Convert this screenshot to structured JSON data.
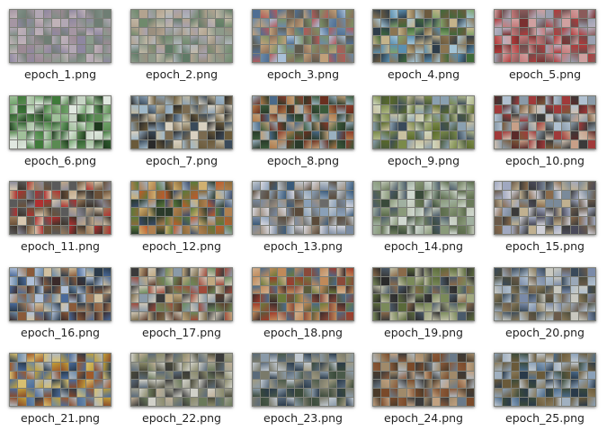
{
  "files": [
    {
      "name": "epoch_1.png",
      "palette": [
        "#8e87a0",
        "#a596a3",
        "#7f8f86",
        "#9b8a94",
        "#b2a7b4",
        "#6f7e74",
        "#c0b2b8",
        "#8a9b8c"
      ]
    },
    {
      "name": "epoch_2.png",
      "palette": [
        "#8d9a8a",
        "#a7a2b0",
        "#6f8a6c",
        "#b3a38f",
        "#c2b8a6",
        "#5f7a66",
        "#9a8f7f",
        "#b0b6bc"
      ]
    },
    {
      "name": "epoch_3.png",
      "palette": [
        "#6b8aa8",
        "#b45a5a",
        "#7c9367",
        "#4f6e93",
        "#c0a07a",
        "#8a6e5a",
        "#a9c0d8",
        "#5e5a4e"
      ]
    },
    {
      "name": "epoch_4.png",
      "palette": [
        "#3f6a3a",
        "#7fa36a",
        "#5a8fb0",
        "#8b7552",
        "#c5b38a",
        "#2e3d4a",
        "#a3c4d6",
        "#6c5a3e"
      ]
    },
    {
      "name": "epoch_5.png",
      "palette": [
        "#b23a3a",
        "#c77a7a",
        "#8a5a5a",
        "#9aa0b0",
        "#d0a0a0",
        "#6a4a4a",
        "#b8b0c0",
        "#7a3030"
      ]
    },
    {
      "name": "epoch_6.png",
      "palette": [
        "#2f5e2f",
        "#6fa36a",
        "#c6d4c4",
        "#3f7a3a",
        "#a0c09a",
        "#1e3a1e",
        "#e0e8e0",
        "#5a8a52"
      ]
    },
    {
      "name": "epoch_7.png",
      "palette": [
        "#3a4a5a",
        "#8aa0b4",
        "#6a5a3a",
        "#c0b8a0",
        "#2a2a2a",
        "#a0b8c8",
        "#7a6a50",
        "#d8d0c0"
      ]
    },
    {
      "name": "epoch_8.png",
      "palette": [
        "#8a3a2a",
        "#b07a4a",
        "#4a6a8a",
        "#3a5a3a",
        "#c0a07a",
        "#6a3020",
        "#9ab0c0",
        "#2a3a2a"
      ]
    },
    {
      "name": "epoch_9.png",
      "palette": [
        "#7a8a4a",
        "#b0b88a",
        "#4a5a3a",
        "#8aa0b0",
        "#c8c0a0",
        "#5a6a2a",
        "#d0d8c0",
        "#3a4a5a"
      ]
    },
    {
      "name": "epoch_10.png",
      "palette": [
        "#a03a3a",
        "#c8a088",
        "#3a3a3a",
        "#b0c0d0",
        "#7a5a3a",
        "#d0c0b0",
        "#5a2a2a",
        "#8a9aa8"
      ]
    },
    {
      "name": "epoch_11.png",
      "palette": [
        "#9a7a5a",
        "#3a3028",
        "#c0a888",
        "#b03030",
        "#5a5a5a",
        "#d8c8b0",
        "#6a5038",
        "#8a8a9a"
      ]
    },
    {
      "name": "epoch_12.png",
      "palette": [
        "#5a7a3a",
        "#c05a2a",
        "#3a4a6a",
        "#d0b070",
        "#8a6a3a",
        "#2a3a2a",
        "#a0b0c0",
        "#b08050"
      ]
    },
    {
      "name": "epoch_13.png",
      "palette": [
        "#7a8aa0",
        "#c0c8d0",
        "#5a4a3a",
        "#3a5a7a",
        "#a09080",
        "#d8d8e0",
        "#6a6a6a",
        "#8aa0b8"
      ]
    },
    {
      "name": "epoch_14.png",
      "palette": [
        "#6a7a5a",
        "#a0b0a0",
        "#3a4a3a",
        "#c0c8b8",
        "#8a9a7a",
        "#4a5a6a",
        "#d0d8d0",
        "#5a6a4a"
      ]
    },
    {
      "name": "epoch_15.png",
      "palette": [
        "#6a5a4a",
        "#a0a8c0",
        "#3a3a3a",
        "#c0b090",
        "#7a8a9a",
        "#8a6a4a",
        "#d0d0d8",
        "#4a4a5a"
      ]
    },
    {
      "name": "epoch_16.png",
      "palette": [
        "#4a6a9a",
        "#3a2a2a",
        "#b0c0d8",
        "#8a5a3a",
        "#6a8aa8",
        "#d0c0a0",
        "#2a3a4a",
        "#a07a5a"
      ]
    },
    {
      "name": "epoch_17.png",
      "palette": [
        "#a04a3a",
        "#6a8a5a",
        "#3a3a3a",
        "#c0a880",
        "#8a9aa8",
        "#5a3a2a",
        "#d0c8b8",
        "#7a6a4a"
      ]
    },
    {
      "name": "epoch_18.png",
      "palette": [
        "#a03a2a",
        "#6a7a3a",
        "#3a2a2a",
        "#c08a5a",
        "#4a6a8a",
        "#d0b090",
        "#8a4a3a",
        "#5a5a3a"
      ]
    },
    {
      "name": "epoch_19.png",
      "palette": [
        "#5a6a3a",
        "#3a3a3a",
        "#a0a880",
        "#8a6a4a",
        "#c0c0a8",
        "#4a5a6a",
        "#7a8a5a",
        "#2a2a2a"
      ]
    },
    {
      "name": "epoch_20.png",
      "palette": [
        "#7a8aa8",
        "#4a4a3a",
        "#b0c0d0",
        "#8a7a5a",
        "#3a4a5a",
        "#c8c8c0",
        "#6a5a4a",
        "#9aa8b8"
      ]
    },
    {
      "name": "epoch_21.png",
      "palette": [
        "#c0a03a",
        "#4a6a9a",
        "#a05a2a",
        "#2a3a4a",
        "#d8c070",
        "#6a8aa8",
        "#8a4a2a",
        "#b0b8c0"
      ]
    },
    {
      "name": "epoch_22.png",
      "palette": [
        "#6a7a5a",
        "#a0a090",
        "#3a3a3a",
        "#c0b098",
        "#5a6a7a",
        "#8a8a6a",
        "#d0d0c8",
        "#4a4a3a"
      ]
    },
    {
      "name": "epoch_23.png",
      "palette": [
        "#5a6a7a",
        "#8a9aa8",
        "#3a4a3a",
        "#a09a80",
        "#c0c8d0",
        "#4a5a4a",
        "#7a7a6a",
        "#2a3a4a"
      ]
    },
    {
      "name": "epoch_24.png",
      "palette": [
        "#8a5a3a",
        "#4a3a2a",
        "#a08a6a",
        "#6a7a8a",
        "#c0a080",
        "#3a3a3a",
        "#b0b8c0",
        "#7a4a2a"
      ]
    },
    {
      "name": "epoch_25.png",
      "palette": [
        "#4a6a8a",
        "#8a7a5a",
        "#2a3a4a",
        "#a0b0c0",
        "#6a5a3a",
        "#c0c8d0",
        "#3a4a3a",
        "#8aa0b8"
      ]
    }
  ]
}
